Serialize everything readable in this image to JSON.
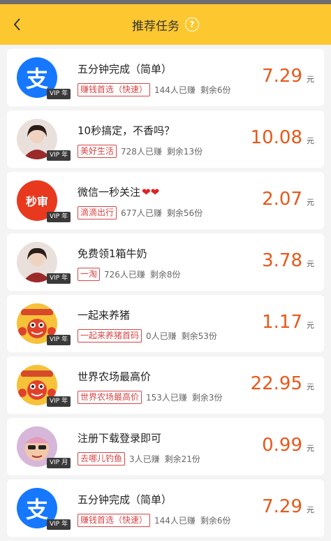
{
  "header": {
    "title": "推荐任务",
    "help_symbol": "?"
  },
  "tasks": [
    {
      "title": "五分钟完成（简单）",
      "hearts": "",
      "tag": "赚钱首选（快速）",
      "earned": "144人已赚",
      "remaining": "剩余6份",
      "price": "7.29",
      "unit": "元",
      "vip": "VIP 年",
      "avatar": "alipay-logo",
      "avatar_text": "支"
    },
    {
      "title": "10秒搞定，不香吗？",
      "hearts": "",
      "tag": "美好生活",
      "earned": "728人已赚",
      "remaining": "剩余13份",
      "price": "10.08",
      "unit": "元",
      "vip": "VIP 年",
      "avatar": "user-photo",
      "avatar_text": ""
    },
    {
      "title": "微信一秒关注",
      "hearts": "❤❤",
      "tag": "滴滴出行",
      "earned": "677人已赚",
      "remaining": "剩余56份",
      "price": "2.07",
      "unit": "元",
      "vip": "VIP 年",
      "avatar": "miaoshen-logo",
      "avatar_text": "秒审"
    },
    {
      "title": "免费领1箱牛奶",
      "hearts": "",
      "tag": "一淘",
      "earned": "726人已赚",
      "remaining": "剩余8份",
      "price": "3.78",
      "unit": "元",
      "vip": "VIP 年",
      "avatar": "user-photo",
      "avatar_text": ""
    },
    {
      "title": "一起来养猪",
      "hearts": "",
      "tag": "一起来养猪首码",
      "earned": "0人已赚",
      "remaining": "剩余53份",
      "price": "1.17",
      "unit": "元",
      "vip": "VIP 年",
      "avatar": "cartoon-lobster",
      "avatar_text": ""
    },
    {
      "title": "世界农场最高价",
      "hearts": "",
      "tag": "世界农场最高价",
      "earned": "153人已赚",
      "remaining": "剩余3份",
      "price": "22.95",
      "unit": "元",
      "vip": "VIP 年",
      "avatar": "cartoon-lobster",
      "avatar_text": ""
    },
    {
      "title": "注册下载登录即可",
      "hearts": "",
      "tag": "去哪儿钓鱼",
      "earned": "3人已赚",
      "remaining": "剩余21份",
      "price": "0.99",
      "unit": "元",
      "vip": "VIP 月",
      "avatar": "cartoon-character",
      "avatar_text": ""
    },
    {
      "title": "五分钟完成（简单）",
      "hearts": "",
      "tag": "赚钱首选（快速）",
      "earned": "144人已赚",
      "remaining": "剩余6份",
      "price": "7.29",
      "unit": "元",
      "vip": "VIP 年",
      "avatar": "alipay-logo",
      "avatar_text": "支"
    }
  ],
  "colors": {
    "header_bg": "#fdc82f",
    "price": "#e8581a",
    "tag": "#d64545",
    "alipay": "#1677ff",
    "miaoshen": "#e8391f"
  }
}
